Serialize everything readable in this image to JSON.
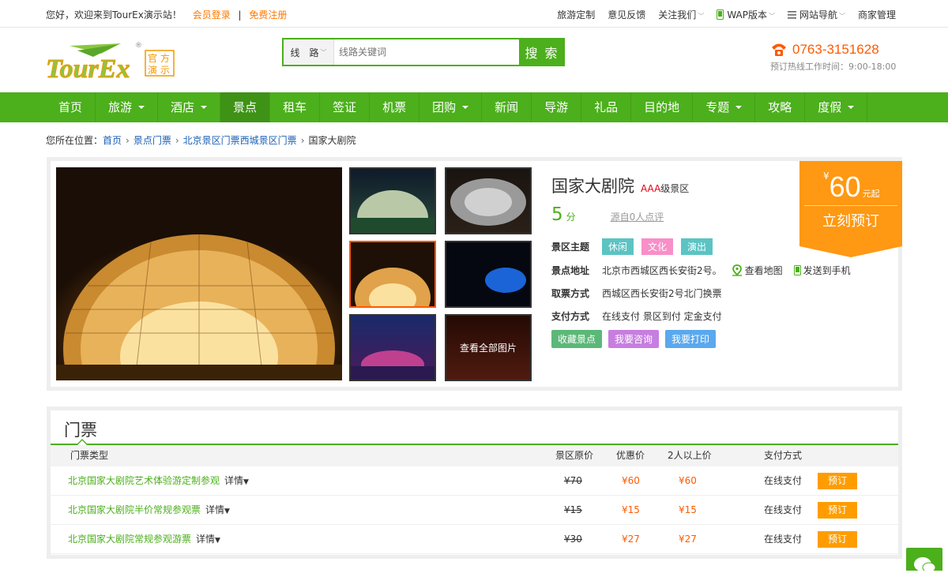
{
  "topbar": {
    "welcome": "您好，欢迎来到TourEx演示站！",
    "login": "会员登录",
    "divider": "|",
    "register": "免费注册",
    "links": [
      "旅游定制",
      "意见反馈",
      "关注我们",
      "WAP版本",
      "网站导航",
      "商家管理"
    ]
  },
  "logo": {
    "text": "TourEx",
    "badge_top": "官 方",
    "badge_bottom": "演 示",
    "reg": "®"
  },
  "search": {
    "category": "线　路",
    "placeholder": "线路关键词",
    "button": "搜 索"
  },
  "hotline": {
    "number": "0763-3151628",
    "hours": "预订热线工作时间：9:00-18:00"
  },
  "nav": {
    "items": [
      {
        "label": "首页"
      },
      {
        "label": "旅游",
        "caret": "▾"
      },
      {
        "label": "酒店",
        "caret": "▾"
      },
      {
        "label": "景点"
      },
      {
        "label": "租车"
      },
      {
        "label": "签证"
      },
      {
        "label": "机票"
      },
      {
        "label": "团购",
        "caret": "▾"
      },
      {
        "label": "新闻"
      },
      {
        "label": "导游"
      },
      {
        "label": "礼品"
      },
      {
        "label": "目的地"
      },
      {
        "label": "专题",
        "caret": "▾"
      },
      {
        "label": "攻略"
      },
      {
        "label": "度假",
        "caret": "▾"
      }
    ]
  },
  "breadcrumb": {
    "prefix": "您所在位置：",
    "items": [
      "首页",
      "景点门票",
      "北京景区门票西城景区门票"
    ],
    "current": "国家大剧院",
    "arrow": "›"
  },
  "detail": {
    "title": "国家大剧院",
    "level_mark": "AAA",
    "level_text": "级景区",
    "score": "5",
    "score_unit": "分",
    "reviews": "源自0人点评",
    "theme_label": "景区主题",
    "themes": [
      {
        "label": "休闲",
        "color": "#5cc3c3"
      },
      {
        "label": "文化",
        "color": "#f88fc8"
      },
      {
        "label": "演出",
        "color": "#5cc3c3"
      }
    ],
    "address_label": "景点地址",
    "address": "北京市西城区西长安街2号。",
    "map_link": "查看地图",
    "send_link": "发送到手机",
    "pickup_label": "取票方式",
    "pickup": "西城区西长安街2号北门换票",
    "pay_label": "支付方式",
    "pay": "在线支付 景区到付 定金支付",
    "actions": [
      {
        "label": "收藏景点",
        "color": "#5cb878"
      },
      {
        "label": "我要咨询",
        "color": "#c77ee0"
      },
      {
        "label": "我要打印",
        "color": "#5aa8ee"
      }
    ],
    "all_photos": "查看全部图片",
    "price_currency": "¥",
    "price": "60",
    "price_suffix": "元起",
    "book_now": "立刻预订"
  },
  "tickets": {
    "title": "门票",
    "headers": {
      "type": "门票类型",
      "original": "景区原价",
      "discount": "优惠价",
      "group": "2人以上价",
      "pay": "支付方式"
    },
    "rows": [
      {
        "name": "北京国家大剧院艺术体验游定制参观",
        "more": "详情",
        "original": "¥70",
        "discount": "¥60",
        "group": "¥60",
        "pay": "在线支付",
        "button": "预订"
      },
      {
        "name": "北京国家大剧院半价常规参观票",
        "more": "详情",
        "original": "¥15",
        "discount": "¥15",
        "group": "¥15",
        "pay": "在线支付",
        "button": "预订"
      },
      {
        "name": "北京国家大剧院常规参观游票",
        "more": "详情",
        "original": "¥30",
        "discount": "¥27",
        "group": "¥27",
        "pay": "在线支付",
        "button": "预订"
      }
    ]
  },
  "colors": {
    "brand_green": "#4caf1c",
    "accent_orange": "#ff9812",
    "price_red": "#ff5a00"
  }
}
